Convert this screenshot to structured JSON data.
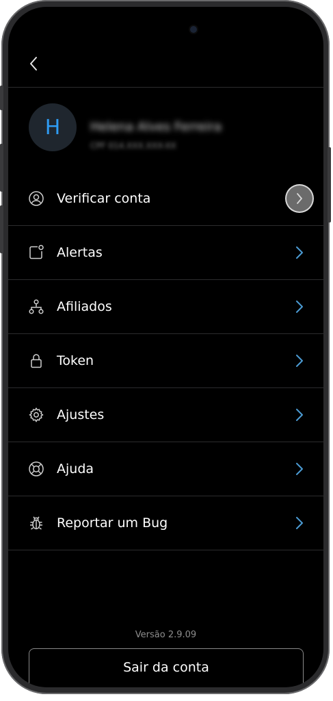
{
  "profile": {
    "initial": "H",
    "name": "Helena Alves Ferreira",
    "document": "CPF 014.XXX.XXX-XX"
  },
  "menu": {
    "items": [
      {
        "label": "Verificar conta",
        "icon": "user-circle-icon"
      },
      {
        "label": "Alertas",
        "icon": "bell-square-icon"
      },
      {
        "label": "Afiliados",
        "icon": "network-icon"
      },
      {
        "label": "Token",
        "icon": "lock-icon"
      },
      {
        "label": "Ajustes",
        "icon": "gear-icon"
      },
      {
        "label": "Ajuda",
        "icon": "lifebuoy-icon"
      },
      {
        "label": "Reportar um Bug",
        "icon": "bug-icon"
      }
    ]
  },
  "footer": {
    "version": "Versão 2.9.09",
    "logout_label": "Sair da conta"
  },
  "colors": {
    "background": "#000000",
    "accent": "#2f9cf3",
    "chevron": "#4b9bd3",
    "divider": "#2c2c2e"
  }
}
